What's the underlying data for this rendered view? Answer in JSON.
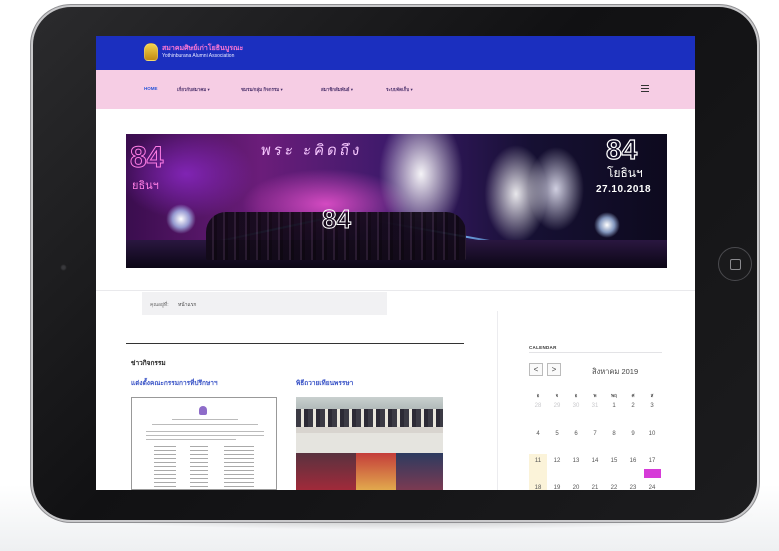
{
  "site": {
    "logo_primary": "สมาคมศิษย์เก่าโยธินบูรณะ",
    "logo_secondary": "Yothinburana Alumni Association"
  },
  "nav": {
    "items": [
      {
        "label": "HOME"
      },
      {
        "label": "เกี่ยวกับสมาคม ▾"
      },
      {
        "label": "ชมรม/กลุ่ม กิจกรรม ▾"
      },
      {
        "label": "สมาชิกสัมพันธ์ ▾"
      },
      {
        "label": "ระบบจัดเก็บ ▾"
      }
    ]
  },
  "banner": {
    "left_number": "84",
    "left_sub": "ยธินฯ",
    "marquee": "พระ ะคิดถึง",
    "center_number": "84",
    "right_number": "84",
    "right_brand": "โยธินฯ",
    "date": "27.10.2018"
  },
  "breadcrumb": {
    "label": "คุณอยู่ที่:",
    "current": "หน้าแรก"
  },
  "news": {
    "section_title": "ข่าวกิจกรรม",
    "posts": [
      {
        "title": "แต่งตั้งคณะกรรมการที่ปรึกษาฯ"
      },
      {
        "title": "พิธีถวายเทียนพรรษา"
      }
    ]
  },
  "calendar": {
    "title": "CALENDAR",
    "prev": "<",
    "next": ">",
    "month_label": "สิงหาคม 2019",
    "weekdays": [
      "อ",
      "จ",
      "อ",
      "พ",
      "พฤ",
      "ศ",
      "ส"
    ],
    "weeks": [
      [
        "28",
        "29",
        "30",
        "31",
        "1",
        "2",
        "3"
      ],
      [
        "4",
        "5",
        "6",
        "7",
        "8",
        "9",
        "10"
      ],
      [
        "11",
        "12",
        "13",
        "14",
        "15",
        "16",
        "17"
      ],
      [
        "18",
        "19",
        "20",
        "21",
        "22",
        "23",
        "24"
      ]
    ],
    "highlight_color": "#d63bd8"
  },
  "colors": {
    "topbar": "#1b2fbf",
    "navbar": "#f6cde4",
    "link": "#3a54c7"
  }
}
